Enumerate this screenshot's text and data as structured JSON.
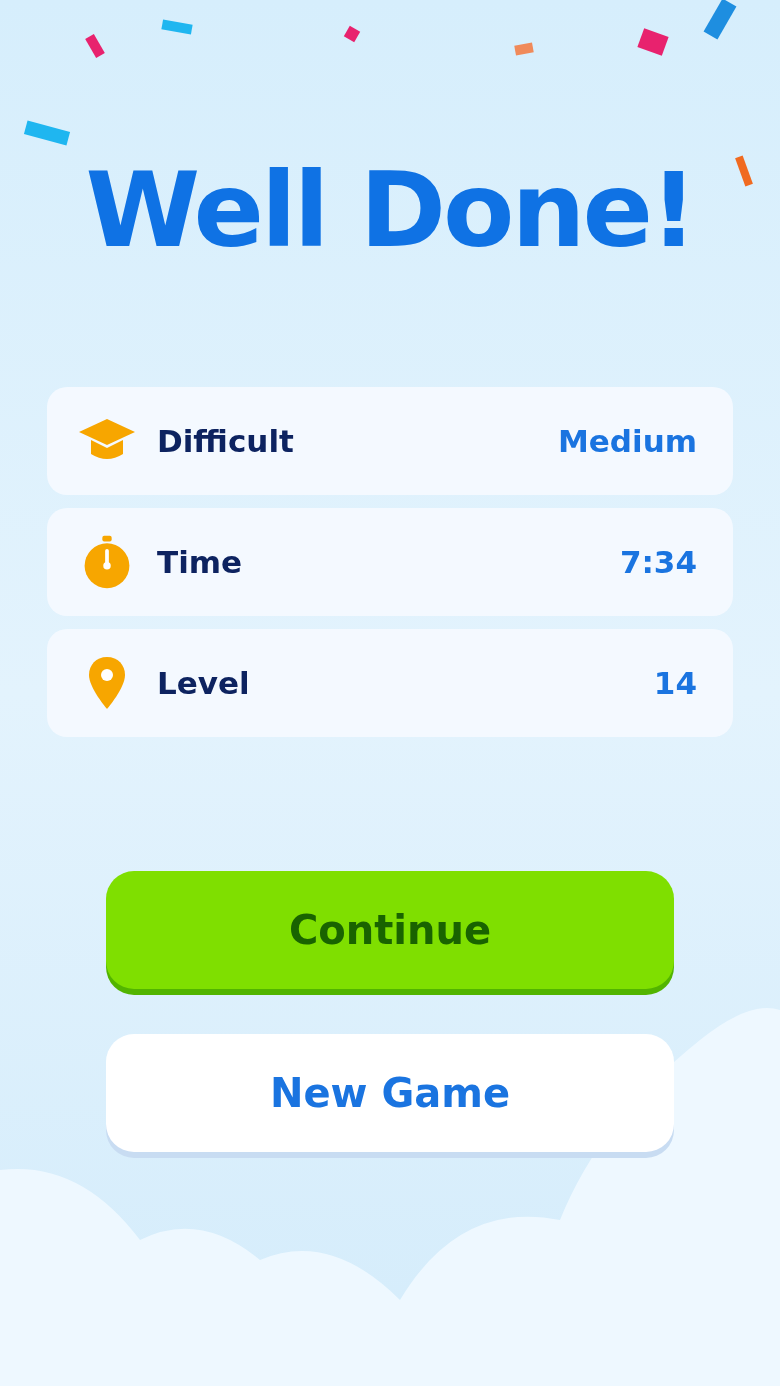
{
  "title": "Well Done!",
  "stats": [
    {
      "kind": "difficulty",
      "label": "Difficult",
      "value": "Medium"
    },
    {
      "kind": "time",
      "label": "Time",
      "value": "7:34"
    },
    {
      "kind": "level",
      "label": "Level",
      "value": "14"
    }
  ],
  "buttons": [
    {
      "kind": "primary",
      "label": "Continue"
    },
    {
      "kind": "secondary",
      "label": "New Game"
    }
  ]
}
